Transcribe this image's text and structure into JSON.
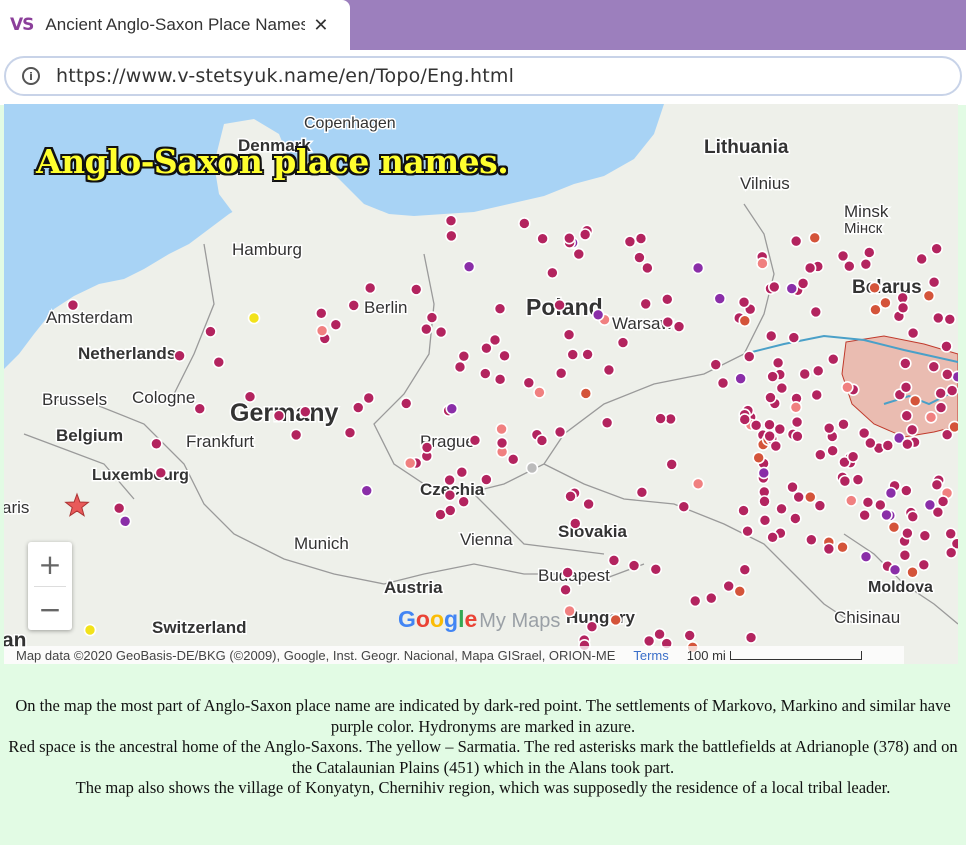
{
  "browser": {
    "tab_logo": "VS",
    "tab_title": "Ancient Anglo-Saxon Place Names",
    "url": "https://www.v-stetsyuk.name/en/Topo/Eng.html"
  },
  "map": {
    "headline": "Anglo-Saxon place names.",
    "labels": [
      {
        "text": "Copenhagen",
        "size": 16,
        "bold": false
      },
      {
        "text": "Denmark",
        "size": 17,
        "bold": true
      },
      {
        "text": "Lithuania",
        "size": 19,
        "bold": true
      },
      {
        "text": "Vilnius",
        "size": 17,
        "bold": false
      },
      {
        "text": "Minsk",
        "size": 17,
        "bold": false
      },
      {
        "text": "Мінск",
        "size": 15,
        "bold": false
      },
      {
        "text": "Hamburg",
        "size": 17,
        "bold": false
      },
      {
        "text": "Belarus",
        "size": 19,
        "bold": true
      },
      {
        "text": "Amsterdam",
        "size": 17,
        "bold": false
      },
      {
        "text": "Berlin",
        "size": 17,
        "bold": false
      },
      {
        "text": "Poland",
        "size": 23,
        "bold": true
      },
      {
        "text": "Warsaw",
        "size": 17,
        "bold": false
      },
      {
        "text": "Netherlands",
        "size": 17,
        "bold": true
      },
      {
        "text": "Brussels",
        "size": 17,
        "bold": false
      },
      {
        "text": "Cologne",
        "size": 17,
        "bold": false
      },
      {
        "text": "Germany",
        "size": 25,
        "bold": true
      },
      {
        "text": "Belgium",
        "size": 17,
        "bold": true
      },
      {
        "text": "Frankfurt",
        "size": 17,
        "bold": false
      },
      {
        "text": "Prague",
        "size": 17,
        "bold": false
      },
      {
        "text": "Luxembourg",
        "size": 16,
        "bold": true
      },
      {
        "text": "Czechia",
        "size": 17,
        "bold": true
      },
      {
        "text": "aris",
        "size": 17,
        "bold": false
      },
      {
        "text": "Munich",
        "size": 17,
        "bold": false
      },
      {
        "text": "Vienna",
        "size": 17,
        "bold": false
      },
      {
        "text": "Slovakia",
        "size": 17,
        "bold": true
      },
      {
        "text": "Budapest",
        "size": 17,
        "bold": false
      },
      {
        "text": "Austria",
        "size": 17,
        "bold": true
      },
      {
        "text": "Hungary",
        "size": 17,
        "bold": true
      },
      {
        "text": "Moldova",
        "size": 16,
        "bold": true
      },
      {
        "text": "Switzerland",
        "size": 17,
        "bold": true
      },
      {
        "text": "Chisinau",
        "size": 17,
        "bold": false
      },
      {
        "text": "an",
        "size": 21,
        "bold": true
      }
    ],
    "zoom_in": "+",
    "zoom_out": "−",
    "google_logo": [
      "G",
      "o",
      "o",
      "g",
      "l",
      "e"
    ],
    "google_suffix": "My Maps",
    "attribution": "Map data ©2020 GeoBasis-DE/BKG (©2009), Google, Inst. Geogr. Nacional, Mapa GISrael, ORION-ME",
    "terms": "Terms",
    "scale": "100 mi",
    "colors": {
      "water": "#a8d3f5",
      "land": "#eef0ea",
      "settlement": "#b3245f",
      "markovo": "#8a2ea8",
      "hydronym": "#5fb8e8",
      "homeland": "#e89a8a",
      "sarmatia": "#f2e21a",
      "battle": "#e85a5a"
    }
  },
  "caption": {
    "p1": "On the map the most part of Anglo-Saxon place name are indicated by dark-red point. The settlements of Markovo, Markino and similar have purple color. Hydronyms are marked in azure.",
    "p2": "Red space is the ancestral home of the Anglo-Saxons. The yellow – Sarmatia. The red asterisks mark the battlefields at Adrianople (378) and on the Catalaunian Plains (451) which in the Alans took part.",
    "p3": "The map also shows the village of Konyatyn, Chernihiv region, which was supposedly the residence of a local tribal leader."
  }
}
